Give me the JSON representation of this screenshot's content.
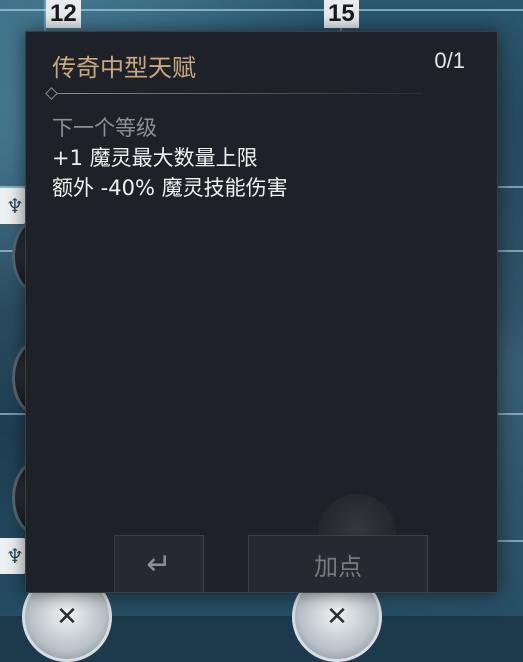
{
  "tree": {
    "tier_labels": [
      "12",
      "15"
    ]
  },
  "popup": {
    "title": "传奇中型天赋",
    "count": "0/1",
    "section_label": "下一个等级",
    "effects": [
      "+1 魔灵最大数量上限",
      "额外 -40% 魔灵技能伤害"
    ],
    "back_icon": "↵",
    "add_label": "加点"
  },
  "colors": {
    "title": "#c9a97f",
    "panel": "#1e2228"
  }
}
